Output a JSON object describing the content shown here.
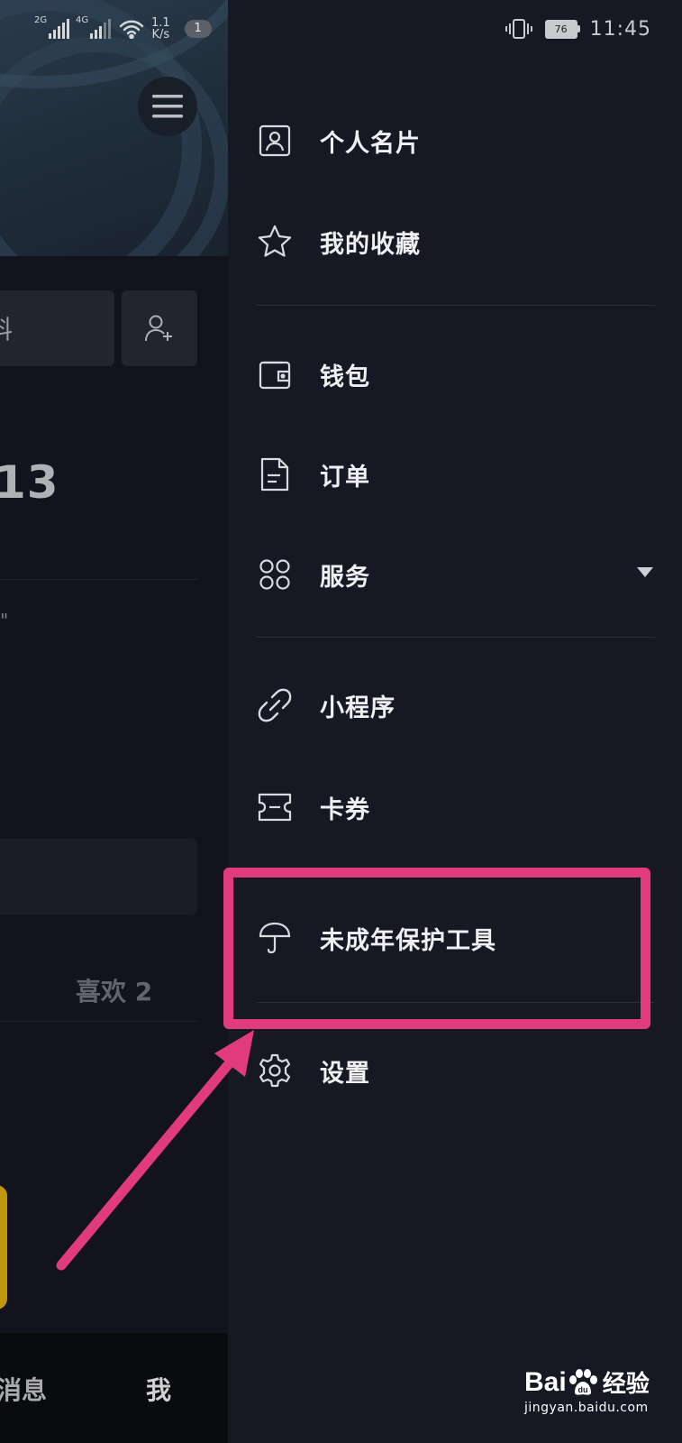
{
  "status_bar": {
    "sim1_label": "2G",
    "sim2_label": "4G",
    "net_speed_value": "1.1",
    "net_speed_unit": "K/s",
    "notification_count": "1",
    "battery_level": "76",
    "time": "11:45"
  },
  "background_page": {
    "edit_button_partial": "料",
    "id_partial": "13",
    "quote_partial": "\"",
    "like_tab": "喜欢 2",
    "nav_messages": "消息",
    "nav_me": "我"
  },
  "drawer": {
    "items": [
      {
        "label": "个人名片",
        "icon": "profile-card-icon"
      },
      {
        "label": "我的收藏",
        "icon": "star-icon"
      },
      {
        "label": "钱包",
        "icon": "wallet-icon"
      },
      {
        "label": "订单",
        "icon": "document-icon"
      },
      {
        "label": "服务",
        "icon": "grid-icon",
        "has_dropdown": true
      },
      {
        "label": "小程序",
        "icon": "link-icon"
      },
      {
        "label": "卡券",
        "icon": "ticket-icon"
      },
      {
        "label": "未成年保护工具",
        "icon": "umbrella-icon",
        "highlighted": true
      },
      {
        "label": "设置",
        "icon": "gear-icon"
      }
    ]
  },
  "annotation": {
    "highlight_color": "#e23b7d"
  },
  "watermark": {
    "brand_left": "Bai",
    "brand_right": "经验",
    "url": "jingyan.baidu.com"
  }
}
